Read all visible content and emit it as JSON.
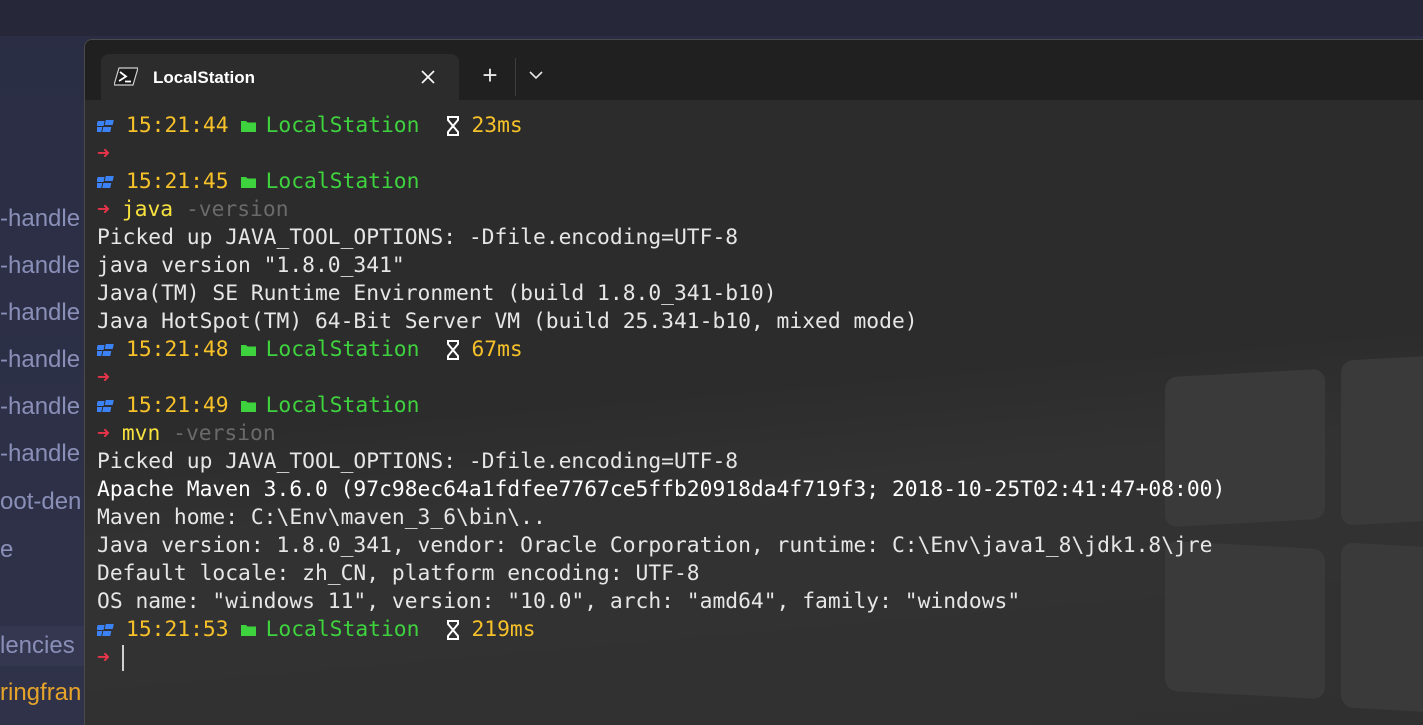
{
  "background_ide": {
    "lines": [
      {
        "text": "-handle",
        "style": "normal"
      },
      {
        "text": "-handle",
        "style": "normal"
      },
      {
        "text": "-handle",
        "style": "normal"
      },
      {
        "text": "-handle",
        "style": "normal"
      },
      {
        "text": "-handle",
        "style": "normal"
      },
      {
        "text": "-handle",
        "style": "normal"
      },
      {
        "text": "oot-den",
        "style": "normal"
      },
      {
        "text": "e",
        "style": "normal"
      },
      {
        "text": "lencies",
        "style": "highlight"
      },
      {
        "text": "ringfran",
        "style": "orange"
      }
    ]
  },
  "window": {
    "tab_title": "LocalStation",
    "tab_icon": "powershell-icon",
    "close_icon": "close-icon",
    "new_tab_label": "+",
    "dropdown_icon": "chevron-down-icon"
  },
  "terminal": {
    "lines": [
      {
        "kind": "prompt",
        "time": "15:21:44",
        "location": "LocalStation",
        "duration": "23ms"
      },
      {
        "kind": "input",
        "arrow": "➜",
        "cmd": "",
        "arg": ""
      },
      {
        "kind": "prompt",
        "time": "15:21:45",
        "location": "LocalStation",
        "duration": ""
      },
      {
        "kind": "input",
        "arrow": "➜",
        "cmd": "java",
        "arg": "-version"
      },
      {
        "kind": "output",
        "text": "Picked up JAVA_TOOL_OPTIONS: -Dfile.encoding=UTF-8"
      },
      {
        "kind": "output",
        "text": "java version \"1.8.0_341\""
      },
      {
        "kind": "output",
        "text": "Java(TM) SE Runtime Environment (build 1.8.0_341-b10)"
      },
      {
        "kind": "output",
        "text": "Java HotSpot(TM) 64-Bit Server VM (build 25.341-b10, mixed mode)"
      },
      {
        "kind": "prompt",
        "time": "15:21:48",
        "location": "LocalStation",
        "duration": "67ms"
      },
      {
        "kind": "input",
        "arrow": "➜",
        "cmd": "",
        "arg": ""
      },
      {
        "kind": "prompt",
        "time": "15:21:49",
        "location": "LocalStation",
        "duration": ""
      },
      {
        "kind": "input",
        "arrow": "➜",
        "cmd": "mvn",
        "arg": "-version"
      },
      {
        "kind": "output",
        "text": "Picked up JAVA_TOOL_OPTIONS: -Dfile.encoding=UTF-8"
      },
      {
        "kind": "output-bright",
        "text": "Apache Maven 3.6.0 (97c98ec64a1fdfee7767ce5ffb20918da4f719f3; 2018-10-25T02:41:47+08:00)"
      },
      {
        "kind": "output",
        "text": "Maven home: C:\\Env\\maven_3_6\\bin\\.."
      },
      {
        "kind": "output",
        "text": "Java version: 1.8.0_341, vendor: Oracle Corporation, runtime: C:\\Env\\java1_8\\jdk1.8\\jre"
      },
      {
        "kind": "output",
        "text": "Default locale: zh_CN, platform encoding: UTF-8"
      },
      {
        "kind": "output",
        "text": "OS name: \"windows 11\", version: \"10.0\", arch: \"amd64\", family: \"windows\""
      },
      {
        "kind": "prompt",
        "time": "15:21:53",
        "location": "LocalStation",
        "duration": "219ms"
      },
      {
        "kind": "cursor",
        "arrow": "➜"
      }
    ]
  },
  "colors": {
    "time": "#f7c12a",
    "location": "#3fd23f",
    "arrow": "#e8344a",
    "command": "#f7e13f",
    "argument": "#6a6a6a",
    "output": "#e6e6e6",
    "windows_logo": "#3b82f6"
  }
}
